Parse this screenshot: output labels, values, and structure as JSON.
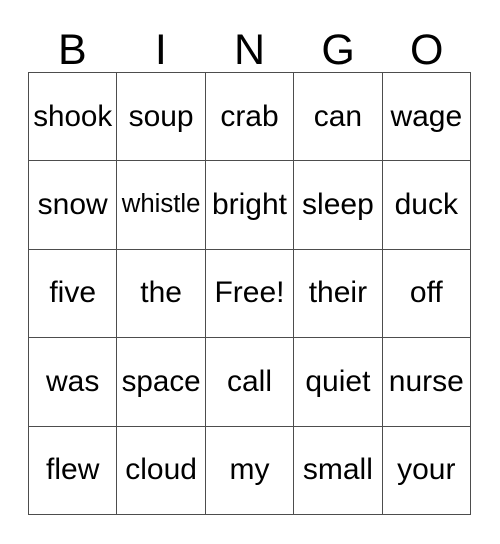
{
  "card": {
    "title": "BINGO",
    "header_letters": [
      "B",
      "I",
      "N",
      "G",
      "O"
    ],
    "grid_size": "5x5",
    "colors": {
      "background": "#ffffff",
      "cell_background": "#ffffff",
      "border": "#4d4d4d",
      "text": "#000000"
    },
    "rows": [
      {
        "index": 1,
        "cells": [
          {
            "text": "shook"
          },
          {
            "text": "soup"
          },
          {
            "text": "crab"
          },
          {
            "text": "can"
          },
          {
            "text": "wage"
          }
        ]
      },
      {
        "index": 2,
        "cells": [
          {
            "text": "snow"
          },
          {
            "text": "whistle"
          },
          {
            "text": "bright"
          },
          {
            "text": "sleep"
          },
          {
            "text": "duck"
          }
        ]
      },
      {
        "index": 3,
        "cells": [
          {
            "text": "five"
          },
          {
            "text": "the"
          },
          {
            "text": "Free!"
          },
          {
            "text": "their"
          },
          {
            "text": "off"
          }
        ]
      },
      {
        "index": 4,
        "cells": [
          {
            "text": "was"
          },
          {
            "text": "space"
          },
          {
            "text": "call"
          },
          {
            "text": "quiet"
          },
          {
            "text": "nurse"
          }
        ]
      },
      {
        "index": 5,
        "cells": [
          {
            "text": "flew"
          },
          {
            "text": "cloud"
          },
          {
            "text": "my"
          },
          {
            "text": "small"
          },
          {
            "text": "your"
          }
        ]
      }
    ]
  }
}
